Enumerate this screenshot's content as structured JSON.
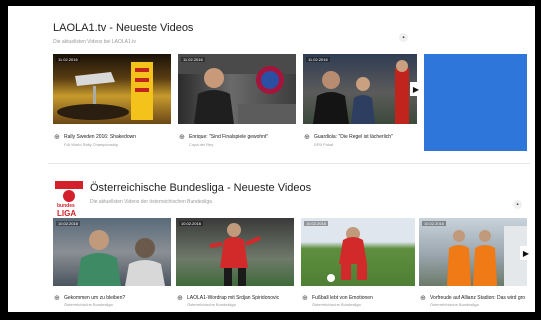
{
  "section1": {
    "title": "LAOLA1.tv - Neueste Videos",
    "subtitle": "Die aktuellsten Videos bei LAOLA1.tv",
    "grid_icon": "grid-icon",
    "videos": [
      {
        "date": "11.02.2016",
        "title": "Rally Sweden 2016: Shakedown",
        "channel": "FIA World Rally Championship"
      },
      {
        "date": "11.02.2016",
        "title": "Enrique: \"Sind Finalspiele gewohnt\"",
        "channel": "Copa del Rey"
      },
      {
        "date": "11.02.2016",
        "title": "Guardiola: \"Die Regel ist lächerlich\"",
        "channel": "DFB Pokal"
      }
    ]
  },
  "section2": {
    "logo_text": [
      "bundes",
      "LIGA"
    ],
    "title": "Österreichische Bundesliga - Neueste Videos",
    "subtitle": "Die aktuellsten Videos der österreichischen Bundesliga",
    "grid_icon": "grid-icon",
    "videos": [
      {
        "date": "10.02.2016",
        "title": "Gekommen um zu bleiben?",
        "channel": "Österreichische Bundesliga"
      },
      {
        "date": "10.02.2016",
        "title": "LAOLA1-Wordrap mit Srdjan Spiridonovic",
        "channel": "Österreichische Bundesliga"
      },
      {
        "date": "10.02.2016",
        "title": "Fußball lebt von Emotionen",
        "channel": "Österreichische Bundesliga"
      },
      {
        "date": "10.02.2016",
        "title": "Vorfreude auf Allianz Stadion: Das wird gro",
        "channel": "Österreichische Bundesliga"
      }
    ]
  },
  "colors": {
    "ad_blue": "#2f76da",
    "logo_red": "#d4202a"
  }
}
